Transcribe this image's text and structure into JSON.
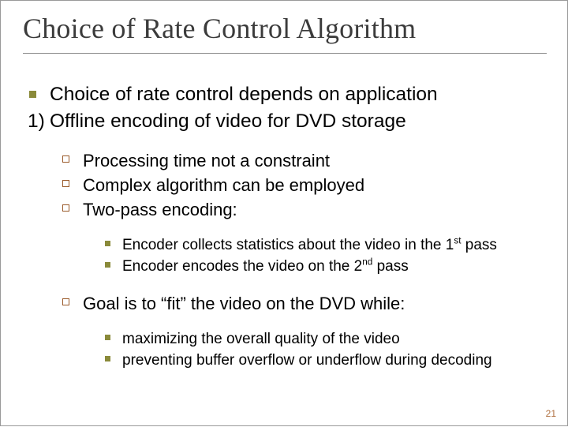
{
  "title": "Choice of Rate Control Algorithm",
  "l1a": "Choice of rate control depends on application",
  "num1_marker": "1)",
  "num1_text": "Offline encoding of video for DVD storage",
  "l2a": "Processing time not a constraint",
  "l2b": "Complex algorithm can be employed",
  "l2c": "Two-pass encoding:",
  "l3a_pre": "Encoder collects statistics about the video in the 1",
  "l3a_sup": "st",
  "l3a_post": " pass",
  "l3b_pre": "Encoder encodes the video on the 2",
  "l3b_sup": "nd",
  "l3b_post": " pass",
  "l2d": "Goal is to “fit” the video on the DVD while:",
  "l3c": "maximizing the overall quality of the video",
  "l3d": "preventing buffer overflow or underflow during decoding",
  "page": "21"
}
